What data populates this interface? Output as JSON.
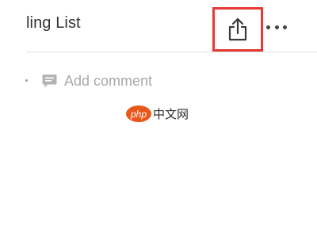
{
  "header": {
    "title": "ling List"
  },
  "toolbar": {
    "share_icon": "share-icon",
    "more_icon": "more-icon",
    "highlight_color": "#e53935"
  },
  "comment": {
    "label": "Add comment",
    "icon": "comment-icon"
  },
  "watermark": {
    "badge": "php",
    "text": "中文网",
    "badge_color": "#e8581c"
  }
}
